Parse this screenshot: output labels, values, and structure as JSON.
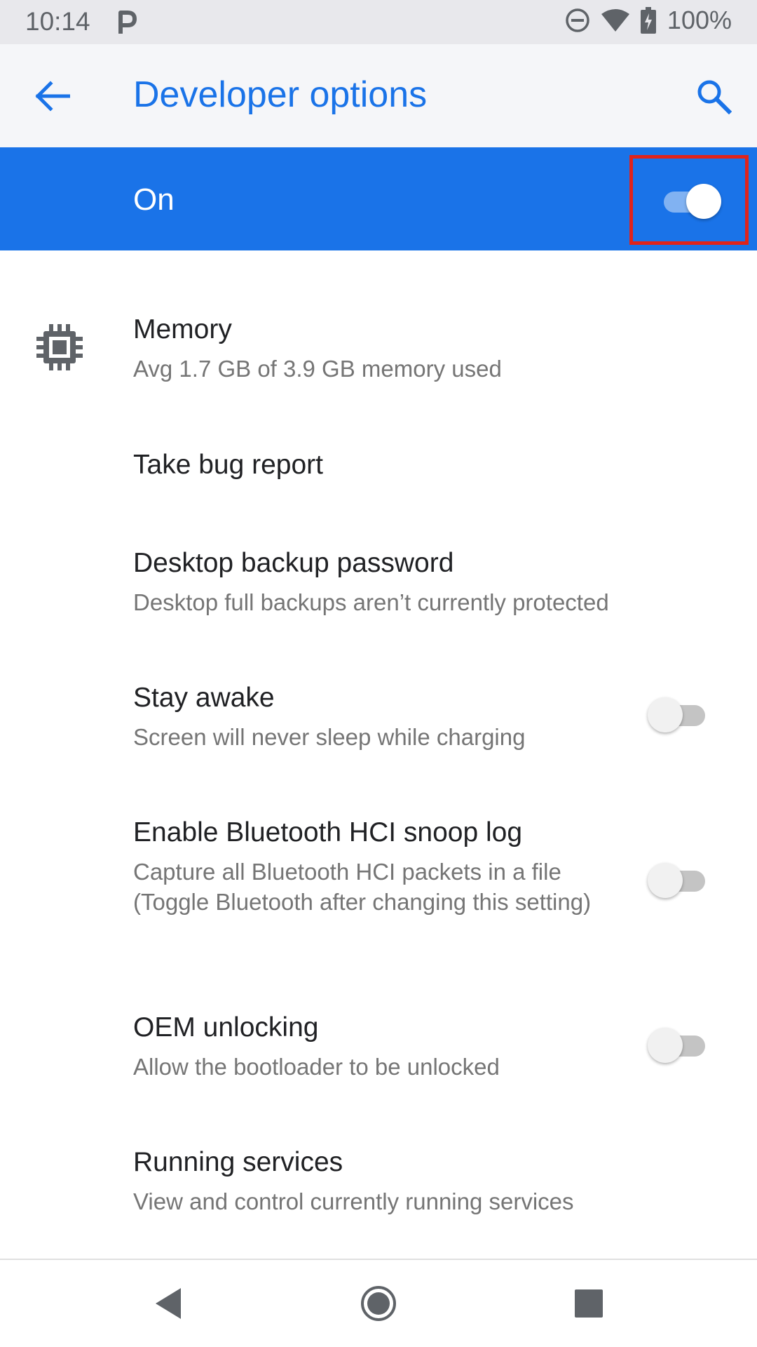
{
  "status_bar": {
    "time": "10:14",
    "battery": "100%",
    "icons": [
      "parking-icon",
      "do-not-disturb-icon",
      "wifi-icon",
      "battery-charging-icon"
    ]
  },
  "app_bar": {
    "title": "Developer options",
    "back_icon": "arrow-back-icon",
    "search_icon": "search-icon",
    "accent_color": "#1a73e8"
  },
  "master_switch": {
    "label": "On",
    "checked": true,
    "background": "#1a73e8",
    "highlight_color": "#e0231b"
  },
  "items": [
    {
      "title": "Memory",
      "subtitle": "Avg 1.7 GB of 3.9 GB memory used",
      "icon": "memory-chip-icon"
    },
    {
      "title": "Take bug report"
    },
    {
      "title": "Desktop backup password",
      "subtitle": "Desktop full backups aren’t currently protected"
    },
    {
      "title": "Stay awake",
      "subtitle": "Screen will never sleep while charging",
      "toggle": false
    },
    {
      "title": "Enable Bluetooth HCI snoop log",
      "subtitle": "Capture all Bluetooth HCI packets in a file (Toggle Bluetooth after changing this setting)",
      "toggle": false
    },
    {
      "title": "OEM unlocking",
      "subtitle": "Allow the bootloader to be unlocked",
      "toggle": false
    },
    {
      "title": "Running services",
      "subtitle": "View and control currently running services"
    }
  ],
  "nav_bar": {
    "icons": [
      "nav-back-icon",
      "nav-home-icon",
      "nav-recents-icon"
    ]
  }
}
